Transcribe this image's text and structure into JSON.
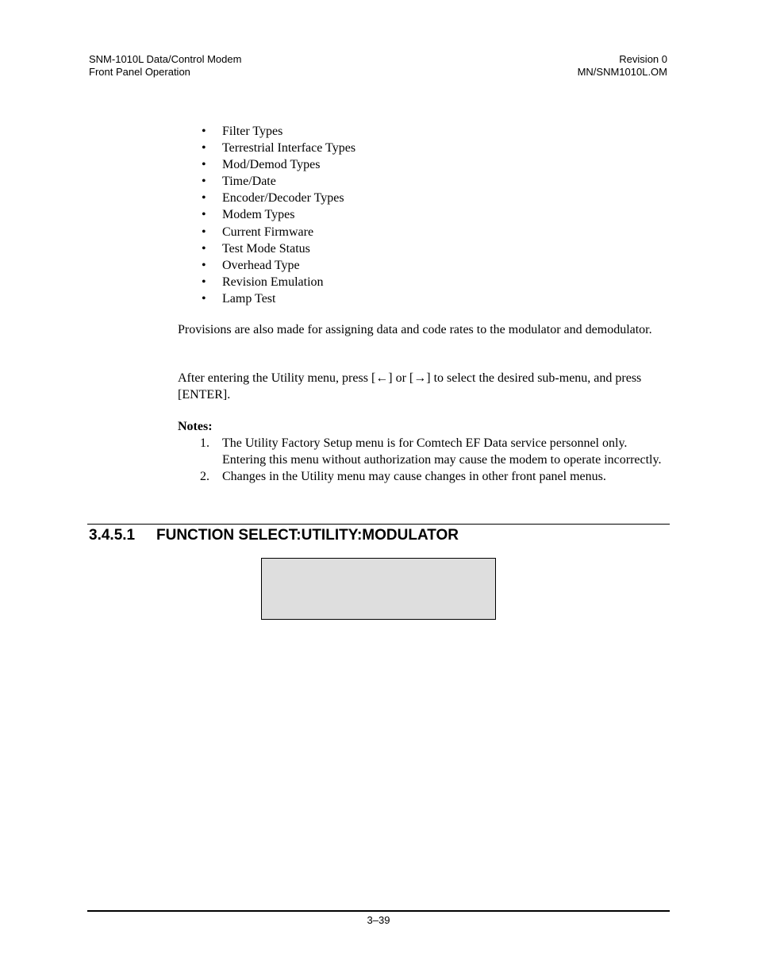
{
  "header": {
    "title": "SNM-1010L Data/Control Modem",
    "subtitle": "Front Panel Operation",
    "revision": "Revision 0",
    "doc_number": "MN/SNM1010L.OM"
  },
  "bullet_glyph": "•",
  "bullets": [
    "Filter Types",
    "Terrestrial Interface Types",
    "Mod/Demod Types",
    "Time/Date",
    "Encoder/Decoder Types",
    "Modem Types",
    "Current Firmware",
    "Test Mode Status",
    "Overhead Type",
    "Revision Emulation",
    "Lamp Test"
  ],
  "paragraphs": [
    "Provisions are also made for assigning data and code rates to the modulator and demodulator.",
    "After entering the Utility menu, press [←] or [→] to select the desired sub-menu, and press [ENTER]."
  ],
  "notes": {
    "title": "Notes:",
    "items": [
      {
        "num": "1.",
        "text": "The Utility Factory Setup menu is for Comtech EF Data service personnel only. Entering this menu without authorization may cause the modem to operate incorrectly."
      },
      {
        "num": "2.",
        "text": "Changes in the Utility menu may cause changes in other front panel menus."
      }
    ]
  },
  "section": {
    "number": "3.4.5.1",
    "title": "FUNCTION SELECT:UTILITY:MODULATOR"
  },
  "panel_display": {
    "fill_color": "#dedede"
  },
  "footer": {
    "page_number": "3–39"
  }
}
